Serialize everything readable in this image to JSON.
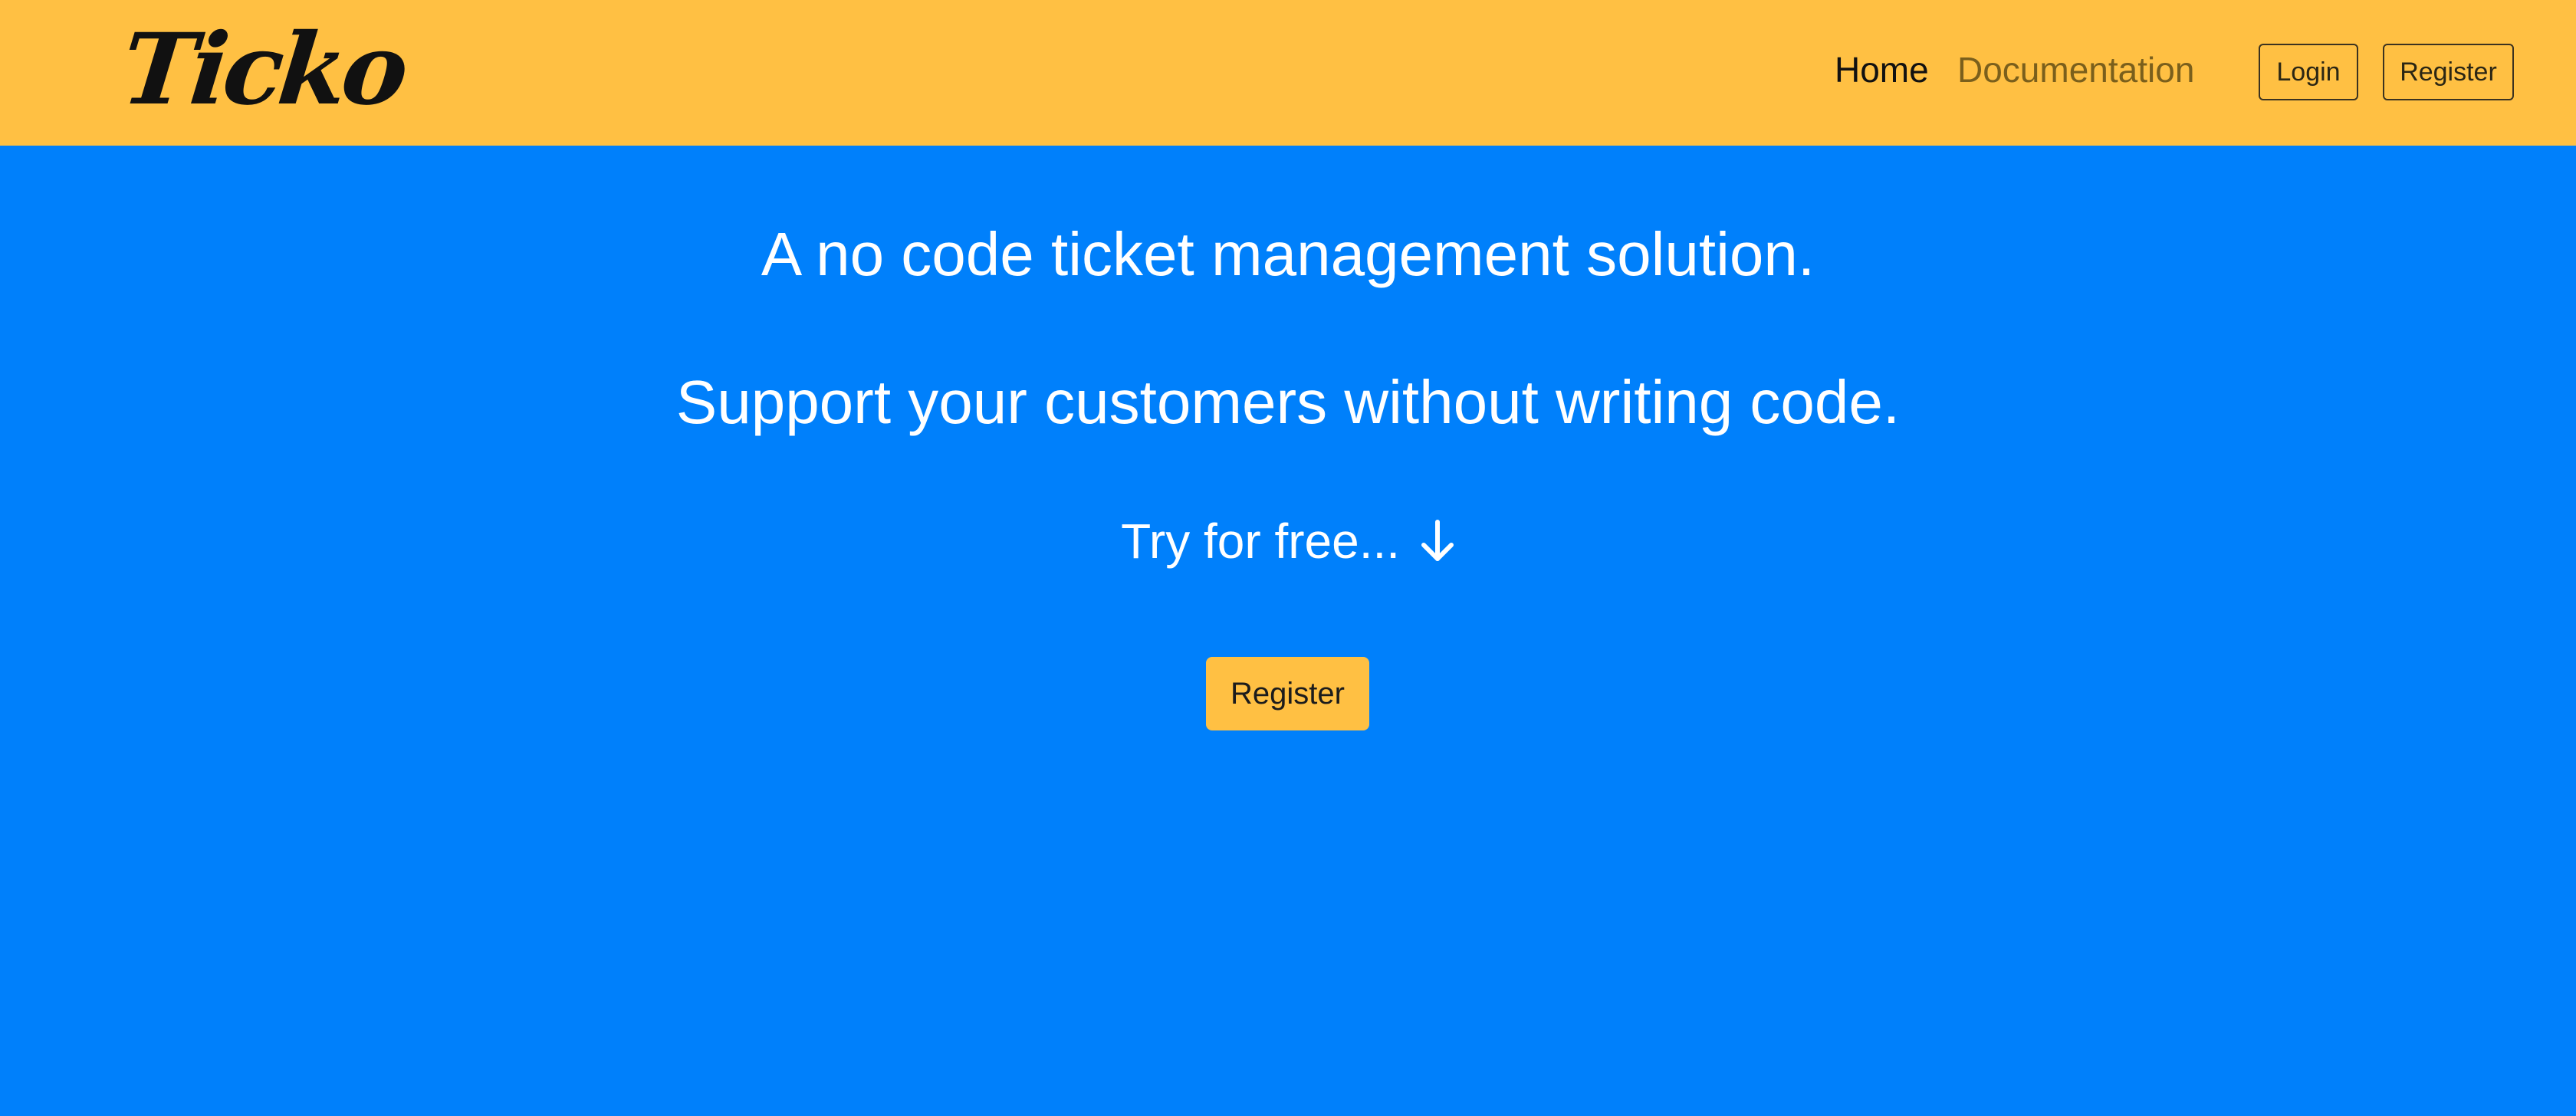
{
  "brand": {
    "logo_text": "Ticko"
  },
  "nav": {
    "home_label": "Home",
    "documentation_label": "Documentation",
    "login_label": "Login",
    "register_label": "Register"
  },
  "hero": {
    "headline_1": "A no code ticket management solution.",
    "headline_2": "Support your customers without writing code.",
    "try_text": "Try for free...",
    "try_icon": "arrow-down-icon",
    "cta_label": "Register"
  },
  "colors": {
    "navbar_bg": "#ffc043",
    "hero_bg": "#0080fb",
    "nav_home": "#111111",
    "nav_doc": "#7a5f1c",
    "hero_text": "#ffffff"
  }
}
